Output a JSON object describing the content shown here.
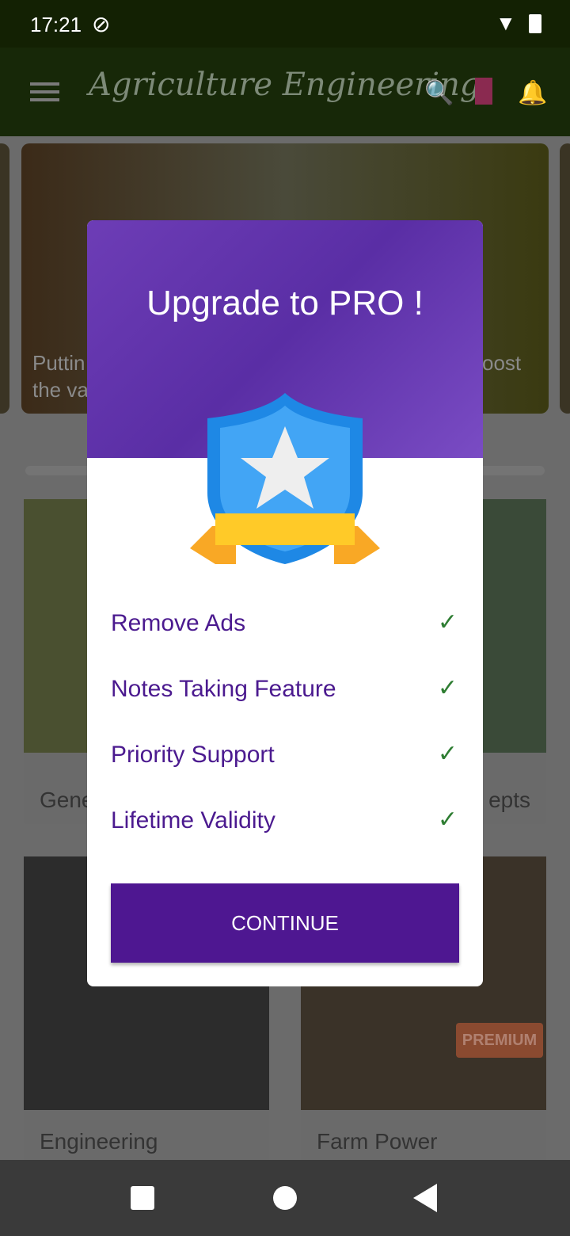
{
  "status_bar": {
    "time": "17:21"
  },
  "app_bar": {
    "title": "Agriculture Engineering"
  },
  "carousel": {
    "left_fragment_1": "Puttin",
    "left_fragment_2": "the va",
    "right_fragment": "oost"
  },
  "grid": [
    {
      "label_fragment": "Gene"
    },
    {
      "label_fragment": "epts"
    },
    {
      "label": "Engineering"
    },
    {
      "label": "Farm Power",
      "badge": "PREMIUM"
    }
  ],
  "dialog": {
    "title": "Upgrade to PRO !",
    "features": [
      {
        "label": "Remove Ads"
      },
      {
        "label": "Notes Taking Feature"
      },
      {
        "label": "Priority Support"
      },
      {
        "label": "Lifetime Validity"
      }
    ],
    "button": "CONTINUE"
  },
  "colors": {
    "accent": "#4e1791",
    "check": "#2e7d32"
  }
}
